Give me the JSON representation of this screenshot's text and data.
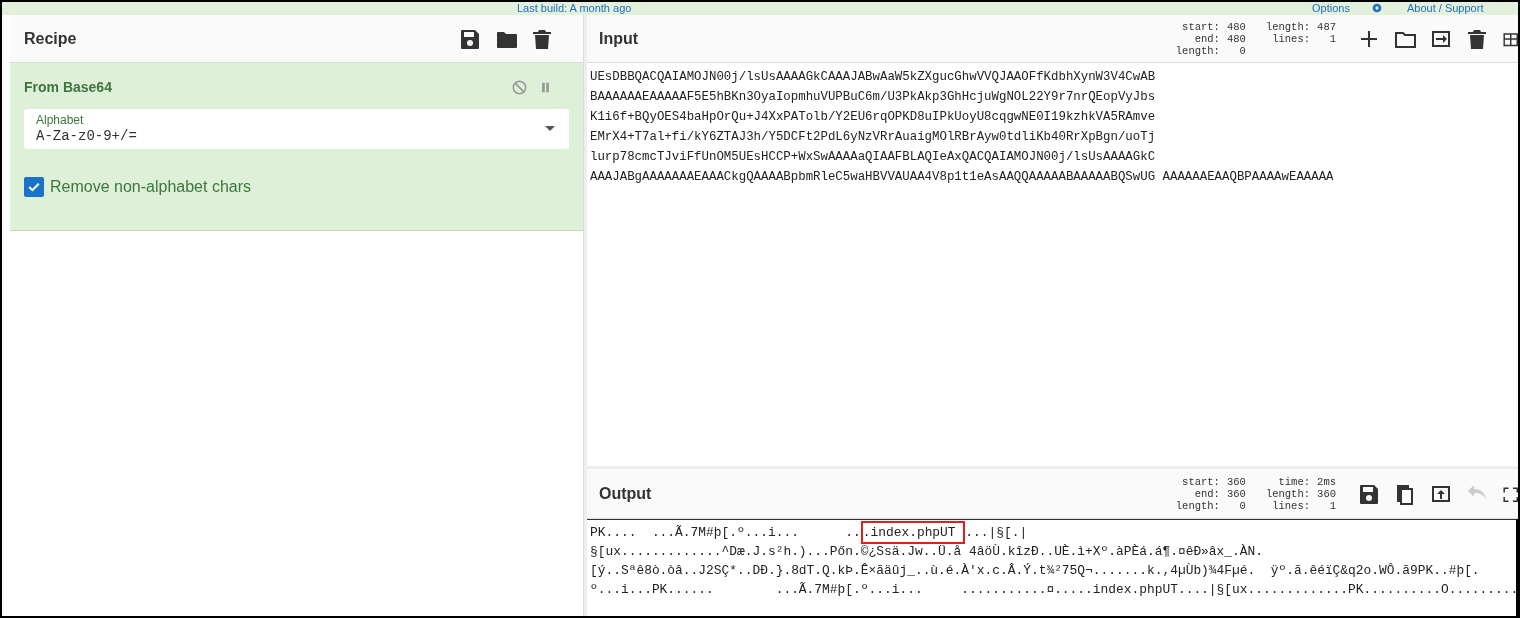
{
  "top_bar": {
    "build_note": "Last build: A month ago",
    "links": [
      "Options",
      "About / Support"
    ]
  },
  "recipe": {
    "title": "Recipe",
    "operations": [
      {
        "name": "From Base64",
        "disabled": false,
        "paused": false,
        "alphabet": {
          "label": "Alphabet",
          "value": "A-Za-z0-9+/="
        },
        "options": [
          {
            "label": "Remove non-alphabet chars",
            "checked": true
          }
        ]
      }
    ]
  },
  "input": {
    "title": "Input",
    "stats": [
      [
        "start:",
        "480"
      ],
      [
        "end:",
        "480"
      ],
      [
        "length:",
        "0"
      ]
    ],
    "stats2": [
      [
        "length:",
        "487"
      ],
      [
        "lines:",
        "1"
      ]
    ],
    "lines": [
      "UEsDBBQACQAIAMOJN00j/lsUsAAAAGkCAAAJABwAaW5kZXgucGhwVVQJAAOFfKdbhXynW3V4CwAB",
      "BAAAAAAEAAAAAF5E5hBKn3OyaIopmhuVUPBuC6m/U3PkAkp3GhHcjuWgNOL22Y9r7nrQEopVyJbs",
      "K1i6f+BQyOES4baHpOrQu+J4XxPATolb/Y2EU6rqOPKD8uIPkUoyU8cqgwNE0I19kzhkVA5RAmve",
      "EMrX4+T7al+fi/kY6ZTAJ3h/Y5DCFt2PdL6yNzVRrAuaigMOlRBrAyw0tdliKb40RrXpBgn/uoTj",
      "lurp78cmcTJviFfUnOM5UEsHCCP+WxSwAAAAaQIAAFBLAQIeAxQACQAIAMOJN00j/lsUsAAAAGkC",
      "AAAJABgAAAAAAAEAAACkgQAAAABpbmRleC5waHBVVAUAA4V8p1t1eAsAAQQAAAAABAAAAABQSwUG AAAAAAEAAQBPAAAAwEAAAAA"
    ]
  },
  "output": {
    "title": "Output",
    "stats": [
      [
        "start:",
        "360"
      ],
      [
        "end:",
        "360"
      ],
      [
        "length:",
        "0"
      ]
    ],
    "stats2": [
      [
        "time:",
        "2ms"
      ],
      [
        "length:",
        "360"
      ],
      [
        "lines:",
        "1"
      ]
    ],
    "lines": [
      [
        {
          "text": "PK....  ...Ã.7M#þ[.º...i...      ..",
          "highlighted": false
        },
        {
          "text": ".index.phpUT ",
          "highlighted": true
        },
        {
          "text": "...|§[.|",
          "highlighted": false
        }
      ],
      [
        {
          "text": "§[ux.............^Dæ.J.s²h.)...Pőn.©¿Ssä.Jw..Ü.å 4âöÙ.kîzÐ..UÈ.ì+Xº.àPÈá.á¶.¤êÐ»âx_.ÀN.",
          "highlighted": false
        }
      ],
      [
        {
          "text": "[ý..Sªê8ò.òâ..J2SÇ*..DÐ.}.8dT.Q.kÞ.Ê×ãäûj_..ù.é.À'x.c.Â.Ý.t¾²75Q¬.......k.,4µÙb)¾4Fµé.  ÿº.ã.êéïÇ&q2o.WÔ.ã9PK..#þ[.",
          "highlighted": false
        }
      ],
      [
        {
          "text": "º...i...PK......        ...Ã.7M#þ[.º...i...     ...........¤.....index.phpUT....|§[ux.............PK..........O.........",
          "highlighted": false
        }
      ]
    ]
  }
}
